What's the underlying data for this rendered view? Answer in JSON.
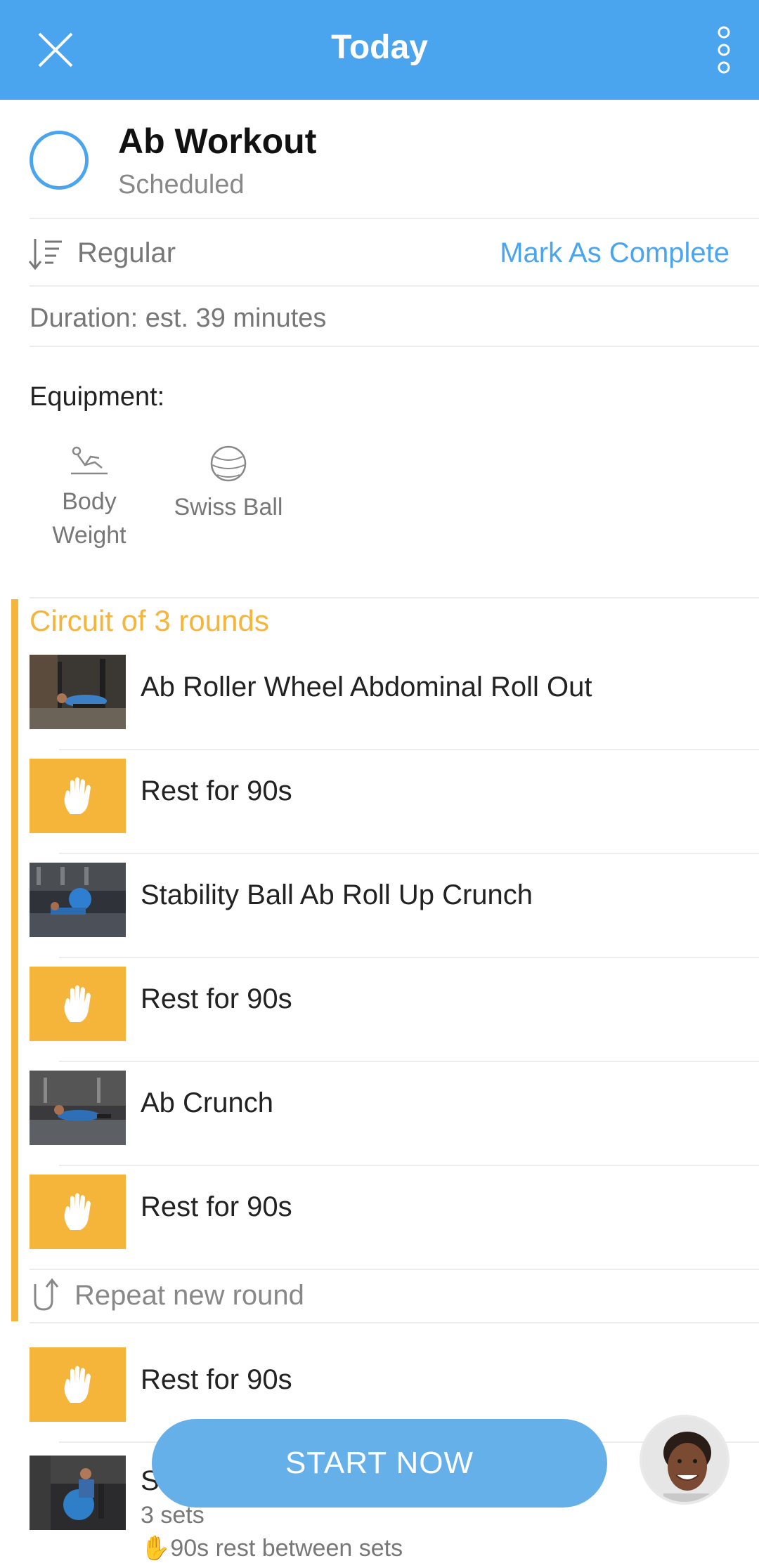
{
  "header": {
    "title": "Today"
  },
  "workout": {
    "name": "Ab Workout",
    "status": "Scheduled",
    "type_label": "Regular",
    "mark_complete": "Mark As Complete",
    "duration": "Duration: est. 39 minutes"
  },
  "equipment": {
    "title": "Equipment:",
    "items": [
      {
        "label_line1": "Body",
        "label_line2": "Weight",
        "icon": "body-weight-icon"
      },
      {
        "label_line1": "Swiss Ball",
        "label_line2": "",
        "icon": "swiss-ball-icon"
      }
    ]
  },
  "circuit": {
    "title": "Circuit of 3 rounds",
    "items": [
      {
        "kind": "exercise",
        "name": "Ab Roller Wheel Abdominal Roll Out"
      },
      {
        "kind": "rest",
        "name": "Rest for 90s"
      },
      {
        "kind": "exercise",
        "name": "Stability Ball Ab Roll Up Crunch"
      },
      {
        "kind": "rest",
        "name": "Rest for 90s"
      },
      {
        "kind": "exercise",
        "name": "Ab Crunch"
      },
      {
        "kind": "rest",
        "name": "Rest for 90s"
      }
    ],
    "repeat_label": "Repeat new round"
  },
  "after_circuit": {
    "rest_label": "Rest for 90s",
    "partial_exercise_letter": "S",
    "sets": "3 sets",
    "rest_between": "90s rest between sets"
  },
  "cta": {
    "start_label": "START NOW"
  },
  "colors": {
    "primary": "#4ba4ee",
    "accent": "#f5b53a",
    "button": "#66b0ea"
  }
}
